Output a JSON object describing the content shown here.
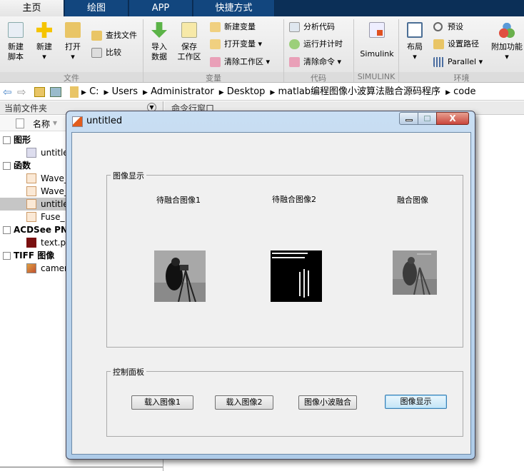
{
  "tabs": [
    {
      "label": "主页",
      "active": true
    },
    {
      "label": "绘图"
    },
    {
      "label": "APP"
    },
    {
      "label": "快捷方式"
    }
  ],
  "ribbon": {
    "file": {
      "new_script": "新建\n脚本",
      "new": "新建",
      "open": "打开",
      "find_files": "查找文件",
      "compare": "比较",
      "section": "文件"
    },
    "variable": {
      "import": "导入\n数据",
      "save_ws": "保存\n工作区",
      "new_var": "新建变量",
      "open_var": "打开变量",
      "clear_ws": "清除工作区",
      "section": "变量"
    },
    "code": {
      "analyze": "分析代码",
      "run_time": "运行并计时",
      "clear_cmd": "清除命令",
      "section": "代码"
    },
    "simulink": {
      "label": "Simulink",
      "section": "SIMULINK"
    },
    "env": {
      "layout": "布局",
      "prefs": "预设",
      "set_path": "设置路径",
      "parallel": "Parallel",
      "addons": "附加功能",
      "section": "环境"
    }
  },
  "address": {
    "path": [
      "C:",
      "Users",
      "Administrator",
      "Desktop",
      "matlab编程图像小波算法融合源码程序",
      "code"
    ]
  },
  "left_panel": {
    "title": "当前文件夹",
    "col_name": "名称",
    "groups": [
      {
        "name": "图形",
        "files": [
          "untitle"
        ]
      },
      {
        "name": "函数",
        "files": [
          "Wave_",
          "Wave_",
          "untitle",
          "Fuse_"
        ]
      },
      {
        "name": "ACDSee PN",
        "files": [
          "text.p"
        ]
      },
      {
        "name": "TIFF 图像",
        "files": [
          "camer"
        ]
      }
    ]
  },
  "command_window": {
    "title": "命令行窗口"
  },
  "dialog": {
    "title": "untitled",
    "display_panel": {
      "title": "图像显示",
      "labels": [
        "待融合图像1",
        "待融合图像2",
        "融合图像"
      ]
    },
    "control_panel": {
      "title": "控制面板",
      "buttons": [
        "载入图像1",
        "载入图像2",
        "图像小波融合",
        "图像显示"
      ]
    }
  },
  "colors": {
    "tab_bar": "#0b2f57",
    "tab": "#12467e",
    "dialog_frame": "#aecbe8",
    "close_button": "#c9463d"
  }
}
